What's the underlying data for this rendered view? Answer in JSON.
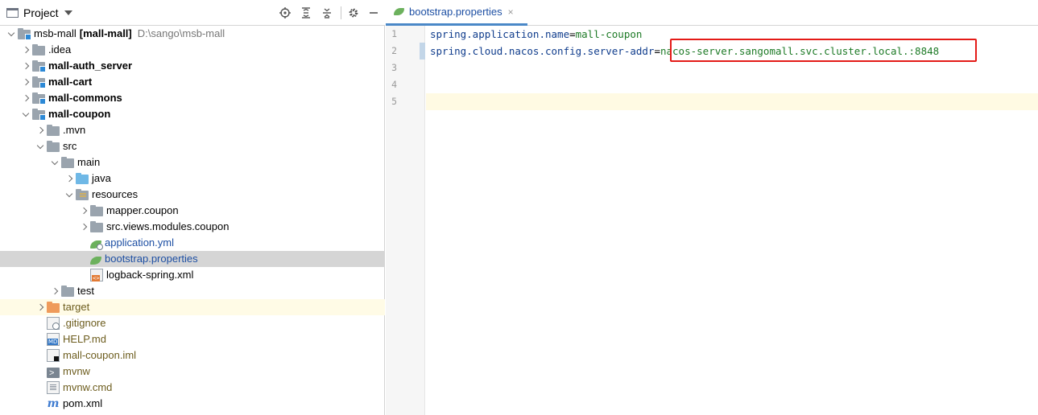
{
  "project_panel": {
    "title": "Project",
    "toolbar_icons": [
      "locate-icon",
      "expand-all-icon",
      "collapse-all-icon",
      "gear-icon",
      "minimize-icon"
    ],
    "tree": [
      {
        "label": "msb-mall",
        "bold_suffix": "[mall-mall]",
        "path": "D:\\sango\\msb-mall",
        "icon": "module-folder-icon",
        "arrow": "down",
        "indent": 0
      },
      {
        "label": ".idea",
        "icon": "folder-icon",
        "arrow": "right",
        "indent": 1
      },
      {
        "label": "mall-auth_server",
        "icon": "module-folder-icon",
        "arrow": "right",
        "indent": 1,
        "bold": true
      },
      {
        "label": "mall-cart",
        "icon": "module-folder-icon",
        "arrow": "right",
        "indent": 1,
        "bold": true
      },
      {
        "label": "mall-commons",
        "icon": "module-folder-icon",
        "arrow": "right",
        "indent": 1,
        "bold": true
      },
      {
        "label": "mall-coupon",
        "icon": "module-folder-icon",
        "arrow": "down",
        "indent": 1,
        "bold": true
      },
      {
        "label": ".mvn",
        "icon": "folder-icon",
        "arrow": "right",
        "indent": 2
      },
      {
        "label": "src",
        "icon": "folder-icon",
        "arrow": "down",
        "indent": 2
      },
      {
        "label": "main",
        "icon": "folder-icon",
        "arrow": "down",
        "indent": 3
      },
      {
        "label": "java",
        "icon": "source-folder-icon",
        "arrow": "right",
        "indent": 4
      },
      {
        "label": "resources",
        "icon": "resources-folder-icon",
        "arrow": "down",
        "indent": 4
      },
      {
        "label": "mapper.coupon",
        "icon": "folder-icon",
        "arrow": "right",
        "indent": 5
      },
      {
        "label": "src.views.modules.coupon",
        "icon": "folder-icon",
        "arrow": "right",
        "indent": 5
      },
      {
        "label": "application.yml",
        "icon": "spring-yml-icon",
        "indent": 5
      },
      {
        "label": "bootstrap.properties",
        "icon": "spring-properties-icon",
        "indent": 5,
        "selected": true
      },
      {
        "label": "logback-spring.xml",
        "icon": "xml-file-icon",
        "indent": 5
      },
      {
        "label": "test",
        "icon": "folder-icon",
        "arrow": "right",
        "indent": 3
      },
      {
        "label": "target",
        "icon": "excluded-folder-icon",
        "arrow": "right",
        "indent": 2,
        "excluded": true
      },
      {
        "label": ".gitignore",
        "icon": "gitignore-file-icon",
        "indent": 2
      },
      {
        "label": "HELP.md",
        "icon": "markdown-file-icon",
        "indent": 2
      },
      {
        "label": "mall-coupon.iml",
        "icon": "iml-file-icon",
        "indent": 2
      },
      {
        "label": "mvnw",
        "icon": "shell-file-icon",
        "indent": 2
      },
      {
        "label": "mvnw.cmd",
        "icon": "cmd-file-icon",
        "indent": 2
      },
      {
        "label": "pom.xml",
        "icon": "maven-icon",
        "indent": 2
      }
    ]
  },
  "editor": {
    "tab": {
      "label": "bootstrap.properties",
      "close": "×"
    },
    "lines": [
      {
        "no": "1",
        "key": "spring.application.name",
        "eq": "=",
        "value": "mall-coupon"
      },
      {
        "no": "2",
        "key": "spring.cloud.nacos.config.server-addr",
        "eq": "=",
        "value": "nacos-server.sangomall.svc.cluster.local.:8848"
      },
      {
        "no": "3",
        "key": "",
        "eq": "",
        "value": ""
      },
      {
        "no": "4",
        "key": "",
        "eq": "",
        "value": ""
      },
      {
        "no": "5",
        "key": "",
        "eq": "",
        "value": ""
      }
    ]
  }
}
